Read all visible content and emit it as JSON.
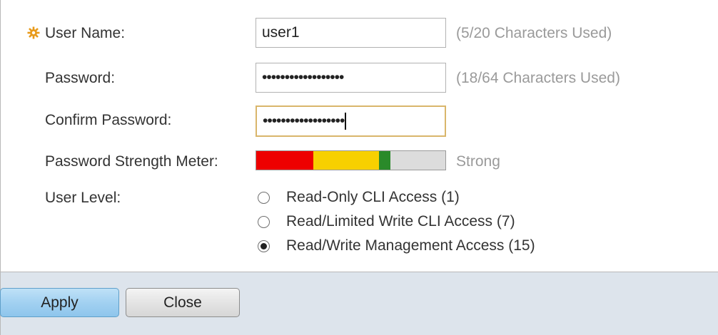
{
  "form": {
    "username": {
      "label": "User Name:",
      "value": "user1",
      "hint": "(5/20 Characters Used)",
      "required_icon": "required-gear-icon"
    },
    "password": {
      "label": "Password:",
      "value": "••••••••••••••••••",
      "hint": "(18/64 Characters Used)"
    },
    "confirm_password": {
      "label": "Confirm Password:",
      "value": "••••••••••••••••••"
    },
    "strength_meter": {
      "label": "Password Strength Meter:",
      "result": "Strong",
      "segments": [
        {
          "color": "#ee0000",
          "fraction": 0.3
        },
        {
          "color": "#f7d000",
          "fraction": 0.35
        },
        {
          "color": "#2a8a2a",
          "fraction": 0.06
        },
        {
          "color": "#dcdcdc",
          "fraction": 0.29
        }
      ]
    },
    "user_level": {
      "label": "User Level:",
      "options": [
        {
          "label": "Read-Only CLI Access (1)",
          "checked": false
        },
        {
          "label": "Read/Limited Write CLI Access (7)",
          "checked": false
        },
        {
          "label": "Read/Write Management Access (15)",
          "checked": true
        }
      ]
    }
  },
  "buttons": {
    "apply_label": "Apply",
    "close_label": "Close"
  },
  "colors": {
    "required_icon": "#e89a1a",
    "footer_bg": "#dde4ec",
    "apply_bg": "#a2d1f1"
  }
}
